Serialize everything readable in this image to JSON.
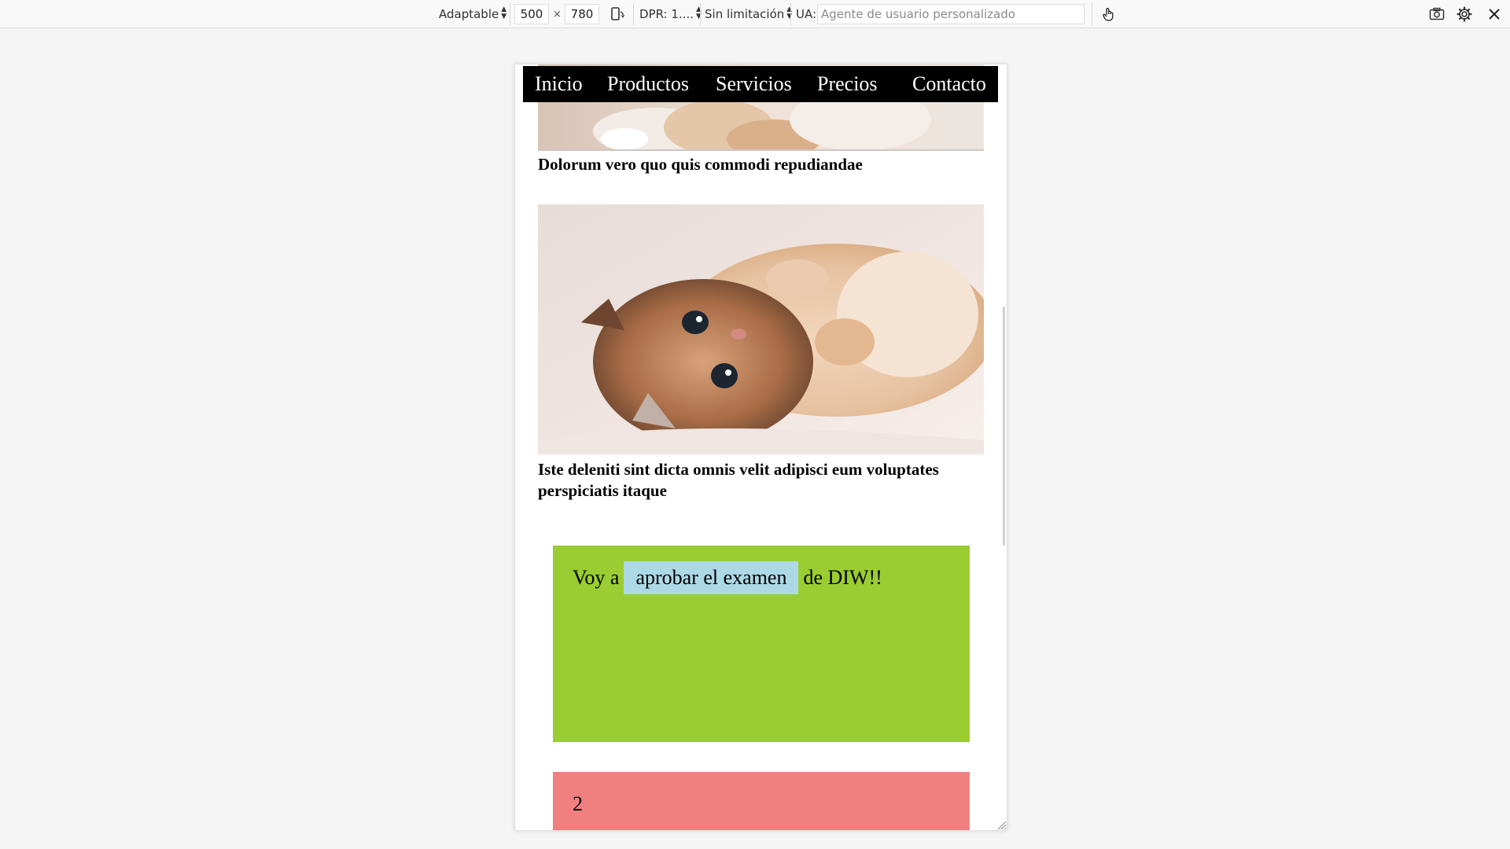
{
  "toolbar": {
    "device_select": "Adaptable",
    "width_value": "500",
    "size_separator": "×",
    "height_value": "780",
    "dpr_select": "DPR: 1....",
    "throttle_select": "Sin limitación",
    "ua_label": "UA:",
    "ua_placeholder": "Agente de usuario personalizado",
    "icons": [
      "rotate-icon",
      "touch-icon",
      "screenshot-icon",
      "settings-icon",
      "close-icon"
    ]
  },
  "site": {
    "nav": {
      "items": [
        "Inicio",
        "Productos",
        "Servicios",
        "Precios",
        "Contacto"
      ]
    },
    "articles": [
      {
        "caption": "Dolorum vero quo quis commodi repudiandae"
      },
      {
        "caption": "Iste deleniti sint dicta omnis velit adipisci eum voluptates perspiciatis itaque"
      }
    ],
    "green_box": {
      "text_before": "Voy a",
      "highlight": "aprobar el examen",
      "text_after": "de DIW!!",
      "color": "#9acd32",
      "highlight_color": "#add8e6"
    },
    "pink_box": {
      "number": "2",
      "color": "#f08080"
    }
  },
  "colors": {
    "nav_background": "#000000",
    "nav_text": "#ffffff",
    "page_background": "#f5f5f5"
  }
}
